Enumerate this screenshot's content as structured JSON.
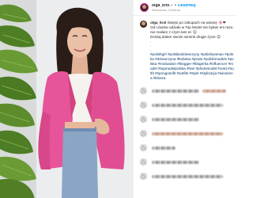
{
  "header": {
    "username": "olga_krol",
    "verified_icon": "verified-badge-icon",
    "separator": "•",
    "follow_label": "Obserwuj",
    "location": "Warszawa, Centrum"
  },
  "caption": {
    "username": "olga_krol",
    "lines": [
      "Święto po zakupach na wiosnę 🌸❤",
      "Od czasów udziału w Top Model nie byłam em razu u",
      "nie mailam z czym lam ec 😉",
      "Dzisiaj dalam swoim wiosnk drugie życie 😊"
    ],
    "dots": [
      ".",
      ".",
      "."
    ],
    "hashtags": "#polishgirl #polskiedziewczyny #polishwoman #polska #dziewczyna #kobieta #pinde #polishmodels #polska #motivation #blogger #blogerka #influencer #model #topmodelpolska #hair #photomodel #ootd #outfit #spnogosrifit #outfits #style #stylizacja #wiosenna #klosza"
  },
  "colors": {
    "link": "#00376b",
    "follow": "#0095f6",
    "jacket": "#e8549a",
    "background": "#ffffff"
  }
}
